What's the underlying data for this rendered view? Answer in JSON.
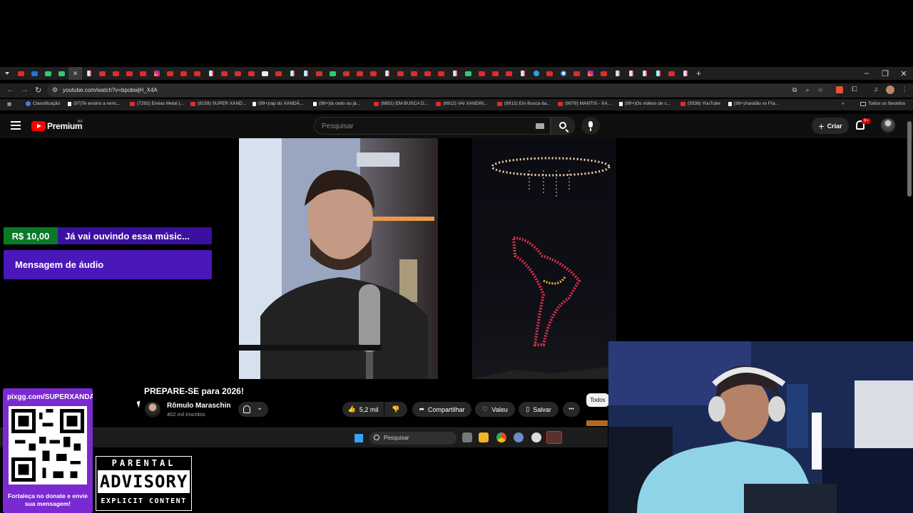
{
  "browser": {
    "url": "youtube.com/watch?v=bpobwjH_X4A",
    "tab_favicons": [
      "yt",
      "bl",
      "gr",
      "gr",
      "active",
      "tt",
      "yt",
      "yt",
      "yt",
      "yt",
      "ig",
      "yt",
      "yt",
      "yt",
      "tt",
      "yt",
      "yt",
      "yt",
      "wh",
      "yt",
      "tt",
      "tt",
      "yt",
      "gr",
      "yt",
      "yt",
      "yt",
      "tt",
      "yt",
      "yt",
      "yt",
      "yt",
      "tt",
      "gr",
      "yt",
      "yt",
      "yt",
      "tt",
      "tg",
      "yt",
      "g",
      "yt",
      "ig",
      "yt",
      "tt",
      "tt",
      "tt",
      "tt",
      "yt",
      "tt"
    ],
    "new_tab": "+",
    "window_controls": {
      "minimize": "–",
      "restore": "❐",
      "close": "✕"
    },
    "bookmarks": [
      {
        "label": "Classificação",
        "icon": "cl"
      },
      {
        "label": "(97)Te ensino a venc...",
        "icon": "tt"
      },
      {
        "label": "(7292) Enéas Metal |...",
        "icon": "yt"
      },
      {
        "label": "(8159) SUPER XAND...",
        "icon": "yt"
      },
      {
        "label": "(99+)rap do XANDÃ...",
        "icon": "tt"
      },
      {
        "label": "(99+)tá cedo ou já...",
        "icon": "tt"
      },
      {
        "label": "(8851) EM BUSCA D...",
        "icon": "yt"
      },
      {
        "label": "(8912) VAI XANDIN...",
        "icon": "yt"
      },
      {
        "label": "(8912) Em Busca da...",
        "icon": "yt"
      },
      {
        "label": "(9078) MANTIS - XA...",
        "icon": "yt"
      },
      {
        "label": "(99+)Os vídeos de c...",
        "icon": "tt"
      },
      {
        "label": "(9338) YouTube",
        "icon": "yt"
      },
      {
        "label": "(99+)Xandão vs Fra...",
        "icon": "tt"
      }
    ],
    "bookmarks_more": "»",
    "all_favorites": "Todos os favoritos"
  },
  "youtube": {
    "brand": "Premium",
    "region": "BR",
    "search_placeholder": "Pesquisar",
    "create_label": "Criar",
    "notifications_badge": "9+",
    "video": {
      "title": "PREPARE-SE para 2026!",
      "channel": "Rômulo Maraschin",
      "subscribers": "402 mil inscritos",
      "likes": "5,2 mil",
      "share_label": "Compartilhar",
      "thanks_label": "Valeu",
      "save_label": "Salvar",
      "more_label": "•••"
    },
    "chip_all": "Todos"
  },
  "donation": {
    "amount": "R$ 10,00",
    "message": "Já vai ouvindo essa músic...",
    "audio_label": "Mensagem de áudio"
  },
  "qr_panel": {
    "url": "pixgg.com/SUPERXANDÃ",
    "caption": "Fortaleça no donate e envie sua mensagem!"
  },
  "parental_advisory": {
    "top": "PARENTAL",
    "middle": "ADVISORY",
    "bottom": "EXPLICIT CONTENT"
  },
  "taskbar": {
    "search_placeholder": "Pesquisar"
  },
  "colors": {
    "donation_purple": "#4a18b8",
    "donation_green": "#0b7a27",
    "qr_purple": "#7a2ad0",
    "youtube_red": "#ff0000"
  }
}
